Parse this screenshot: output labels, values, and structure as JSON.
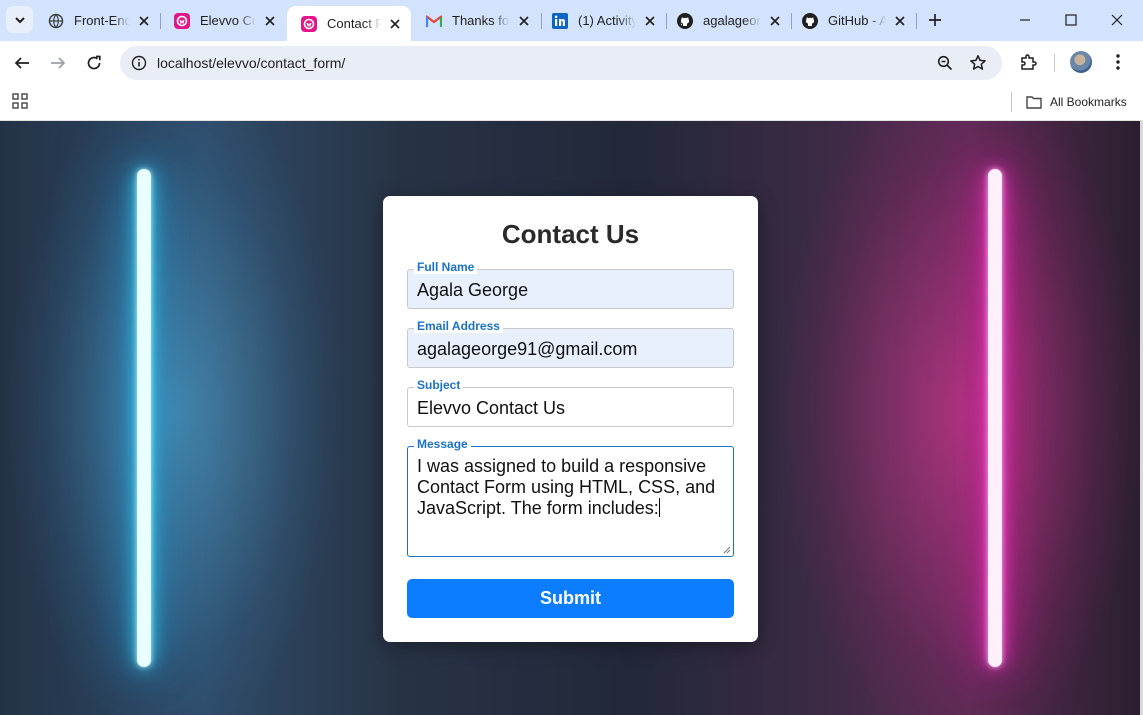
{
  "tabs": [
    {
      "title": "Front-End",
      "icon": "globe-icon"
    },
    {
      "title": "Elevvo Co",
      "icon": "elevvo-icon"
    },
    {
      "title": "Contact Fo",
      "icon": "elevvo-icon",
      "active": true
    },
    {
      "title": "Thanks for",
      "icon": "gmail-icon"
    },
    {
      "title": "(1) Activity",
      "icon": "linkedin-icon"
    },
    {
      "title": "agalageorg",
      "icon": "github-icon"
    },
    {
      "title": "GitHub - A",
      "icon": "github-icon"
    }
  ],
  "address_bar": {
    "url": "localhost/elevvo/contact_form/"
  },
  "bookmarks": {
    "all_label": "All Bookmarks"
  },
  "form": {
    "title": "Contact Us",
    "full_name": {
      "label": "Full Name",
      "value": "Agala George"
    },
    "email": {
      "label": "Email Address",
      "value": "agalageorge91@gmail.com"
    },
    "subject": {
      "label": "Subject",
      "value": "Elevvo Contact Us"
    },
    "message": {
      "label": "Message",
      "value": "I was assigned to build a responsive Contact Form using HTML, CSS, and JavaScript. The form includes:"
    },
    "submit_label": "Submit"
  },
  "colors": {
    "accent": "#0d7dff",
    "label_blue": "#1a73c8",
    "autofill_bg": "#e8f0fe",
    "tabstrip": "#d3e3fd",
    "neon_left": "#39d6ff",
    "neon_right": "#ff3fd2"
  }
}
